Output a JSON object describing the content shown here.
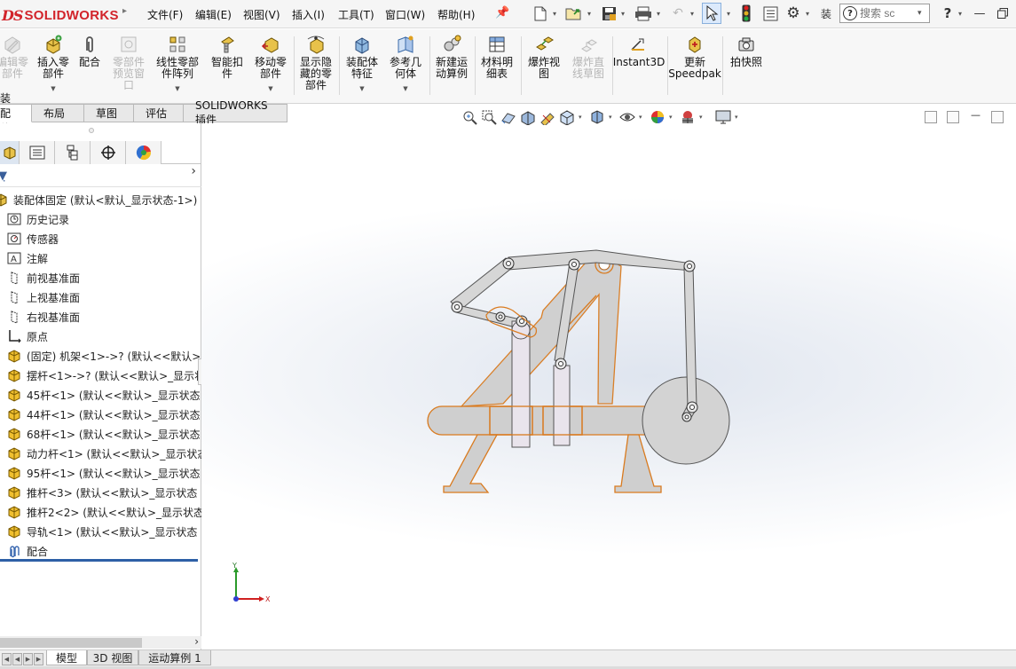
{
  "app": {
    "logo_mark": "DS",
    "logo_text": "SOLIDWORKS"
  },
  "menu": [
    {
      "label": "文件(F)"
    },
    {
      "label": "编辑(E)"
    },
    {
      "label": "视图(V)"
    },
    {
      "label": "插入(I)"
    },
    {
      "label": "工具(T)"
    },
    {
      "label": "窗口(W)"
    },
    {
      "label": "帮助(H)"
    }
  ],
  "quick_access": {
    "icons": [
      "new-document-icon",
      "open-icon",
      "save-icon",
      "print-icon",
      "undo-icon",
      "select-icon",
      "rebuild-traffic-light-icon",
      "file-properties-icon",
      "options-gear-icon"
    ],
    "truncated_label": "装",
    "search_placeholder": "搜索 sc",
    "help": "?"
  },
  "ribbon": {
    "buttons": [
      {
        "label": "编辑零\n部件",
        "icon": "edit-component-icon",
        "enabled": false
      },
      {
        "label": "插入零\n部件",
        "icon": "insert-component-icon",
        "enabled": true,
        "dropdown": true
      },
      {
        "label": "配合",
        "icon": "mate-paperclip-icon",
        "enabled": true
      },
      {
        "label": "零部件\n预览窗\n口",
        "icon": "component-preview-icon",
        "enabled": false
      },
      {
        "label": "线性零部\n件阵列",
        "icon": "linear-pattern-icon",
        "enabled": true,
        "dropdown": true
      },
      {
        "label": "智能扣\n件",
        "icon": "smart-fasteners-icon",
        "enabled": true
      },
      {
        "label": "移动零\n部件",
        "icon": "move-component-icon",
        "enabled": true,
        "dropdown": true
      },
      {
        "label": "显示隐\n藏的零\n部件",
        "icon": "show-hidden-icon",
        "enabled": true
      },
      {
        "label": "装配体\n特征",
        "icon": "assembly-features-icon",
        "enabled": true,
        "dropdown": true
      },
      {
        "label": "参考几\n何体",
        "icon": "reference-geometry-icon",
        "enabled": true,
        "dropdown": true
      },
      {
        "label": "新建运\n动算例",
        "icon": "new-motion-study-icon",
        "enabled": true
      },
      {
        "label": "材料明\n细表",
        "icon": "bill-of-materials-icon",
        "enabled": true
      },
      {
        "label": "爆炸视\n图",
        "icon": "exploded-view-icon",
        "enabled": true
      },
      {
        "label": "爆炸直\n线草图",
        "icon": "explode-line-sketch-icon",
        "enabled": false
      },
      {
        "label": "Instant3D",
        "icon": "instant3d-icon",
        "enabled": true
      },
      {
        "label": "更新\nSpeedpak",
        "icon": "speedpak-icon",
        "enabled": true
      },
      {
        "label": "拍快照",
        "icon": "snapshot-camera-icon",
        "enabled": true
      }
    ]
  },
  "tabs": [
    {
      "label": "装配体",
      "active": true
    },
    {
      "label": "布局"
    },
    {
      "label": "草图"
    },
    {
      "label": "评估"
    },
    {
      "label": "SOLIDWORKS 插件"
    }
  ],
  "feature_manager": {
    "tabs": [
      "feature-manager-icon",
      "property-manager-icon",
      "configuration-manager-icon",
      "dimxpert-icon",
      "display-manager-icon"
    ],
    "root": "装配体固定 (默认<默认_显示状态-1>)",
    "items": [
      {
        "label": "历史记录",
        "icon": "history-icon"
      },
      {
        "label": "传感器",
        "icon": "sensors-icon"
      },
      {
        "label": "注解",
        "icon": "annotations-icon"
      },
      {
        "label": "前视基准面",
        "icon": "plane-icon"
      },
      {
        "label": "上视基准面",
        "icon": "plane-icon"
      },
      {
        "label": "右视基准面",
        "icon": "plane-icon"
      },
      {
        "label": "原点",
        "icon": "origin-icon"
      },
      {
        "label": "(固定) 机架<1>->? (默认<<默认>_",
        "icon": "part-icon"
      },
      {
        "label": "摆杆<1>->? (默认<<默认>_显示状",
        "icon": "part-icon"
      },
      {
        "label": "45杆<1> (默认<<默认>_显示状态",
        "icon": "part-icon"
      },
      {
        "label": "44杆<1> (默认<<默认>_显示状态",
        "icon": "part-icon"
      },
      {
        "label": "68杆<1> (默认<<默认>_显示状态",
        "icon": "part-icon"
      },
      {
        "label": "动力杆<1> (默认<<默认>_显示状态",
        "icon": "part-icon"
      },
      {
        "label": "95杆<1> (默认<<默认>_显示状态",
        "icon": "part-icon"
      },
      {
        "label": "推杆<3> (默认<<默认>_显示状态 1",
        "icon": "part-icon"
      },
      {
        "label": "推杆2<2> (默认<<默认>_显示状态",
        "icon": "part-icon"
      },
      {
        "label": "导轨<1> (默认<<默认>_显示状态 1",
        "icon": "part-icon"
      },
      {
        "label": "配合",
        "icon": "mates-icon"
      }
    ]
  },
  "viewport": {
    "triad": {
      "x": "X",
      "y": "Y"
    },
    "highlight_color": "#d97a1e",
    "part_fill": "#cfcfcf"
  },
  "bottom_tabs": [
    {
      "label": "模型",
      "active": true
    },
    {
      "label": "3D 视图"
    },
    {
      "label": "运动算例 1"
    }
  ]
}
